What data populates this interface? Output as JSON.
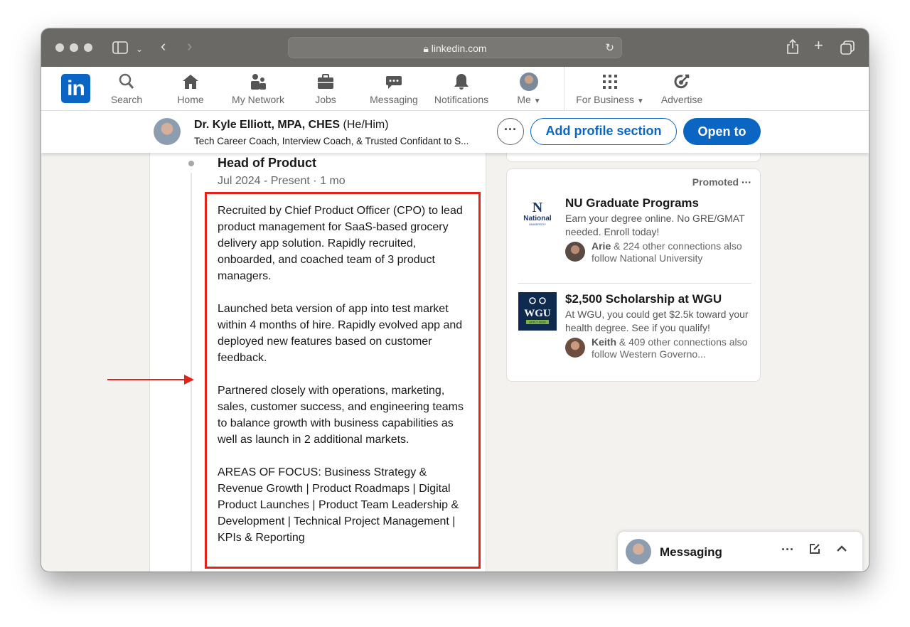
{
  "browser": {
    "url": "linkedin.com"
  },
  "nav": {
    "items": [
      {
        "label": "Search",
        "icon": "search-icon"
      },
      {
        "label": "Home",
        "icon": "home-icon"
      },
      {
        "label": "My Network",
        "icon": "network-icon"
      },
      {
        "label": "Jobs",
        "icon": "briefcase-icon"
      },
      {
        "label": "Messaging",
        "icon": "chat-icon"
      },
      {
        "label": "Notifications",
        "icon": "bell-icon"
      },
      {
        "label": "Me",
        "icon": "avatar"
      },
      {
        "label": "For Business",
        "icon": "grid-icon"
      },
      {
        "label": "Advertise",
        "icon": "advertise-icon"
      }
    ]
  },
  "profile_bar": {
    "name": "Dr. Kyle Elliott, MPA, CHES",
    "pronouns": "(He/Him)",
    "headline": "Tech Career Coach, Interview Coach, & Trusted Confidant to S...",
    "more_label": "···",
    "add_section_label": "Add profile section",
    "open_to_label": "Open to"
  },
  "experience": {
    "title": "Head of Product",
    "dates": "Jul 2024 - Present · 1 mo",
    "paragraphs": [
      "Recruited by Chief Product Officer (CPO) to lead product management for SaaS-based grocery delivery app solution. Rapidly recruited, onboarded, and coached team of 3 product managers.",
      "Launched beta version of app into test market within 4 months of hire. Rapidly evolved app and deployed new features based on customer feedback.",
      "Partnered closely with operations, marketing, sales, customer success, and engineering teams to balance growth with business capabilities as well as launch in 2 additional markets.",
      "AREAS OF FOCUS: Business Strategy & Revenue Growth | Product Roadmaps | Digital Product Launches | Product Team Leadership & Development | Technical Project Management | KPIs & Reporting"
    ]
  },
  "ads": {
    "promoted_label": "Promoted",
    "items": [
      {
        "logo_text": "National",
        "logo_sub": "UNIVERSITY",
        "title": "NU Graduate Programs",
        "subtitle": "Earn your degree online. No GRE/GMAT needed. Enroll today!",
        "conn_name": "Arie",
        "conn_text": "& 224 other connections also follow National University"
      },
      {
        "logo_text": "WGU",
        "logo_sub": "APPLY NOW",
        "title": "$2,500 Scholarship at WGU",
        "subtitle": "At WGU, you could get $2.5k toward your health degree. See if you qualify!",
        "conn_name": "Keith",
        "conn_text": "& 409 other connections also follow Western Governo..."
      }
    ]
  },
  "messaging_dock": {
    "label": "Messaging"
  },
  "colors": {
    "linkedin_blue": "#0a66c2",
    "highlight_red": "#e2231a"
  }
}
